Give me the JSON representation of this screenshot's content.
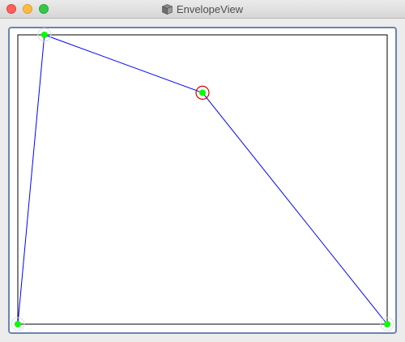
{
  "window": {
    "title": "EnvelopeView",
    "app_icon": "box-icon"
  },
  "traffic_lights": {
    "close_color": "#fc605b",
    "minimize_color": "#fdbc40",
    "maximize_color": "#34c84a"
  },
  "envelope": {
    "line_color": "#0000ff",
    "point_color": "#00ff00",
    "selection_color": "#d00000",
    "border_color": "#000000",
    "selected_point_index": 2,
    "points": [
      {
        "x": 0.0,
        "y": 0.0
      },
      {
        "x": 0.072,
        "y": 1.0
      },
      {
        "x": 0.5,
        "y": 0.8
      },
      {
        "x": 1.0,
        "y": 0.0
      }
    ]
  }
}
